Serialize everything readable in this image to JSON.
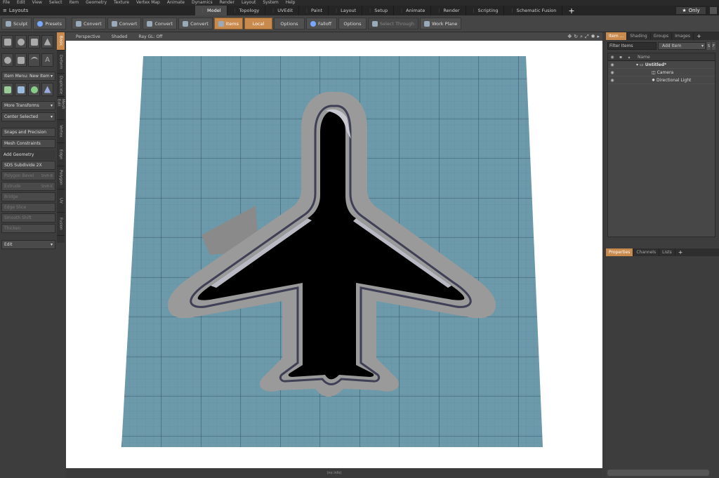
{
  "menubar": [
    "File",
    "Edit",
    "View",
    "Select",
    "Item",
    "Geometry",
    "Texture",
    "Vertex Map",
    "Animate",
    "Dynamics",
    "Render",
    "Layout",
    "System",
    "Help"
  ],
  "layouts_label": "Layouts",
  "layout_tabs": [
    "Model",
    "Topology",
    "UVEdit",
    "Paint",
    "Layout",
    "Setup",
    "Animate",
    "Render",
    "Scripting",
    "Schematic Fusion"
  ],
  "active_tab": "Model",
  "only_label": "Only",
  "toolbar": {
    "sculpt": "Sculpt",
    "presets": "Presets",
    "convert": [
      "Convert",
      "Convert",
      "Convert",
      "Convert"
    ],
    "items": "Items",
    "local": "Local",
    "options1": "Options",
    "falloff": "Falloff",
    "options2": "Options",
    "select_through": "Select Through",
    "work_plane": "Work Plane"
  },
  "left_panel": {
    "item_menu": "Item Menu: New Item",
    "more_transforms": "More Transforms",
    "center_selected": "Center Selected",
    "snaps": "Snaps and Precision",
    "mesh_constraints": "Mesh Constraints",
    "add_geometry": "Add Geometry",
    "sds_subdivide": "SDS Subdivide 2X",
    "polygon_bevel": "Polygon Bevel",
    "polygon_bevel_key": "Shift-B",
    "extrude": "Extrude",
    "extrude_key": "Shift-X",
    "bridge": "Bridge",
    "edge_slice": "Edge Slice",
    "smooth_shift": "Smooth Shift",
    "thicken": "Thicken",
    "edit": "Edit",
    "side_tabs": [
      "Basic",
      "Deform",
      "Duplicate",
      "Mesh Edit",
      "Vertex",
      "Edge",
      "Polygon",
      "UV",
      "Fusion"
    ]
  },
  "viewport": {
    "perspective": "Perspective",
    "shaded": "Shaded",
    "ray_gl": "Ray GL: Off",
    "status": "(no info)"
  },
  "right_panel": {
    "top_tabs": [
      "Item ...",
      "Shading",
      "Groups",
      "Images"
    ],
    "filter_placeholder": "Filter Items",
    "add_item": "Add Item",
    "name_header": "Name",
    "items": [
      "Untitled*",
      "Camera",
      "Directional Light"
    ],
    "bottom_tabs": [
      "Properties",
      "Channels",
      "Lists"
    ]
  },
  "colors": {
    "accent": "#c98a4e",
    "grid": "#6d9aab",
    "object": "#9a9a9a"
  }
}
